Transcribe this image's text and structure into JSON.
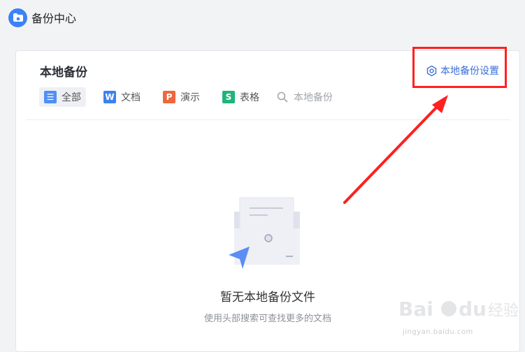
{
  "app": {
    "title": "备份中心"
  },
  "panel": {
    "title": "本地备份",
    "settings_label": "本地备份设置"
  },
  "tabs": [
    {
      "label": "全部",
      "icon": "list-icon",
      "glyph": "☰",
      "color": "#4f8ff7",
      "active": true
    },
    {
      "label": "文档",
      "icon": "word-doc-icon",
      "glyph": "W",
      "color": "#3c82f0",
      "active": false
    },
    {
      "label": "演示",
      "icon": "presentation-icon",
      "glyph": "P",
      "color": "#f0673d",
      "active": false
    },
    {
      "label": "表格",
      "icon": "spreadsheet-icon",
      "glyph": "S",
      "color": "#1fb47a",
      "active": false
    }
  ],
  "search": {
    "placeholder": "本地备份"
  },
  "empty_state": {
    "title": "暂无本地备份文件",
    "subtitle": "使用头部搜索可查找更多的文档"
  },
  "watermark": {
    "text": "jingyan.baidu.com",
    "logo_text": "Bai du 经验"
  },
  "colors": {
    "accent": "#3a6fd8",
    "annotation": "#ff2020"
  }
}
